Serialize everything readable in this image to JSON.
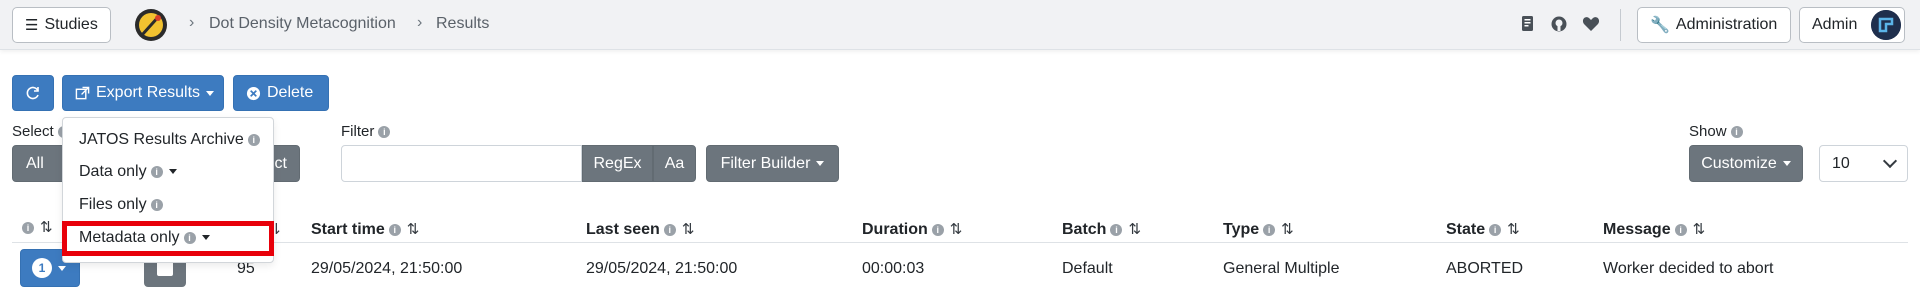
{
  "nav": {
    "studies_label": "Studies",
    "breadcrumb": [
      "Dot Density Metacognition",
      "Results"
    ],
    "admin_label": "Administration",
    "user_label": "Admin"
  },
  "toolbar": {
    "export_label": "Export Results",
    "delete_label": "Delete"
  },
  "export_menu": {
    "items": [
      "JATOS Results Archive",
      "Data only",
      "Files only",
      "Metadata only"
    ]
  },
  "select": {
    "label": "Select",
    "all_label": "All",
    "select_label": "ct"
  },
  "filter": {
    "label": "Filter",
    "value": "",
    "regex_label": "RegEx",
    "case_label": "Aa",
    "builder_label": "Filter Builder"
  },
  "show": {
    "label": "Show",
    "customize_label": "Customize",
    "page_size": "10"
  },
  "table": {
    "columns": {
      "result_fragment": "lt",
      "start_time": "Start time",
      "last_seen": "Last seen",
      "duration": "Duration",
      "batch": "Batch",
      "type": "Type",
      "state": "State",
      "message": "Message"
    },
    "rows": [
      {
        "index": "1",
        "result_id": "95",
        "start_time": "29/05/2024, 21:50:00",
        "last_seen": "29/05/2024, 21:50:00",
        "duration": "00:00:03",
        "batch": "Default",
        "type": "General Multiple",
        "state": "ABORTED",
        "message": "Worker decided to abort"
      }
    ]
  },
  "colors": {
    "primary": "#3d7bc0",
    "secondary": "#6c757d",
    "highlight": "#e8000a",
    "navbar_bg": "#f1f2f4"
  }
}
